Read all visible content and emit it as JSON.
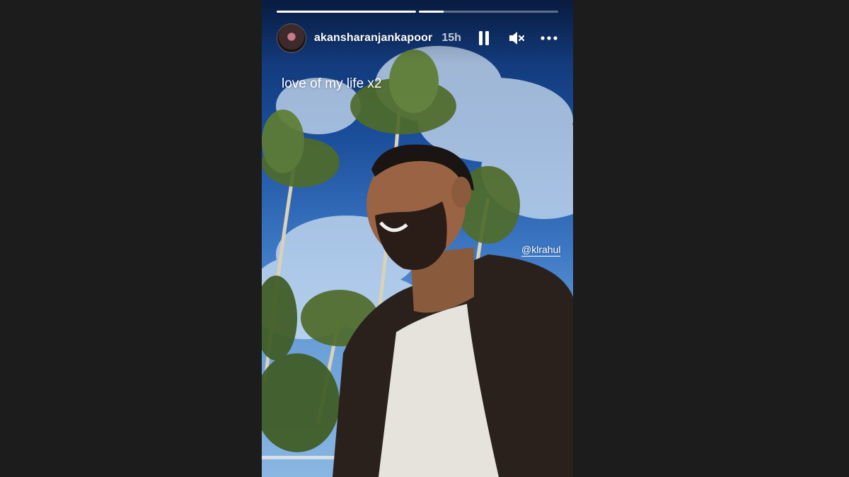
{
  "story": {
    "progress": [
      1.0,
      0.18
    ],
    "user": {
      "username": "akansharanjankapoor",
      "time": "15h"
    },
    "controls": {
      "pause_icon": "pause-icon",
      "mute_icon": "muted-speaker-icon",
      "more_icon": "more-options-icon"
    },
    "caption": "love of my life x2",
    "mention": "@klrahul"
  },
  "colors": {
    "page_background": "#1c1c1c",
    "sky_top": "#0d2b63",
    "sky_bottom": "#8ab6e2",
    "text": "#ffffff"
  }
}
